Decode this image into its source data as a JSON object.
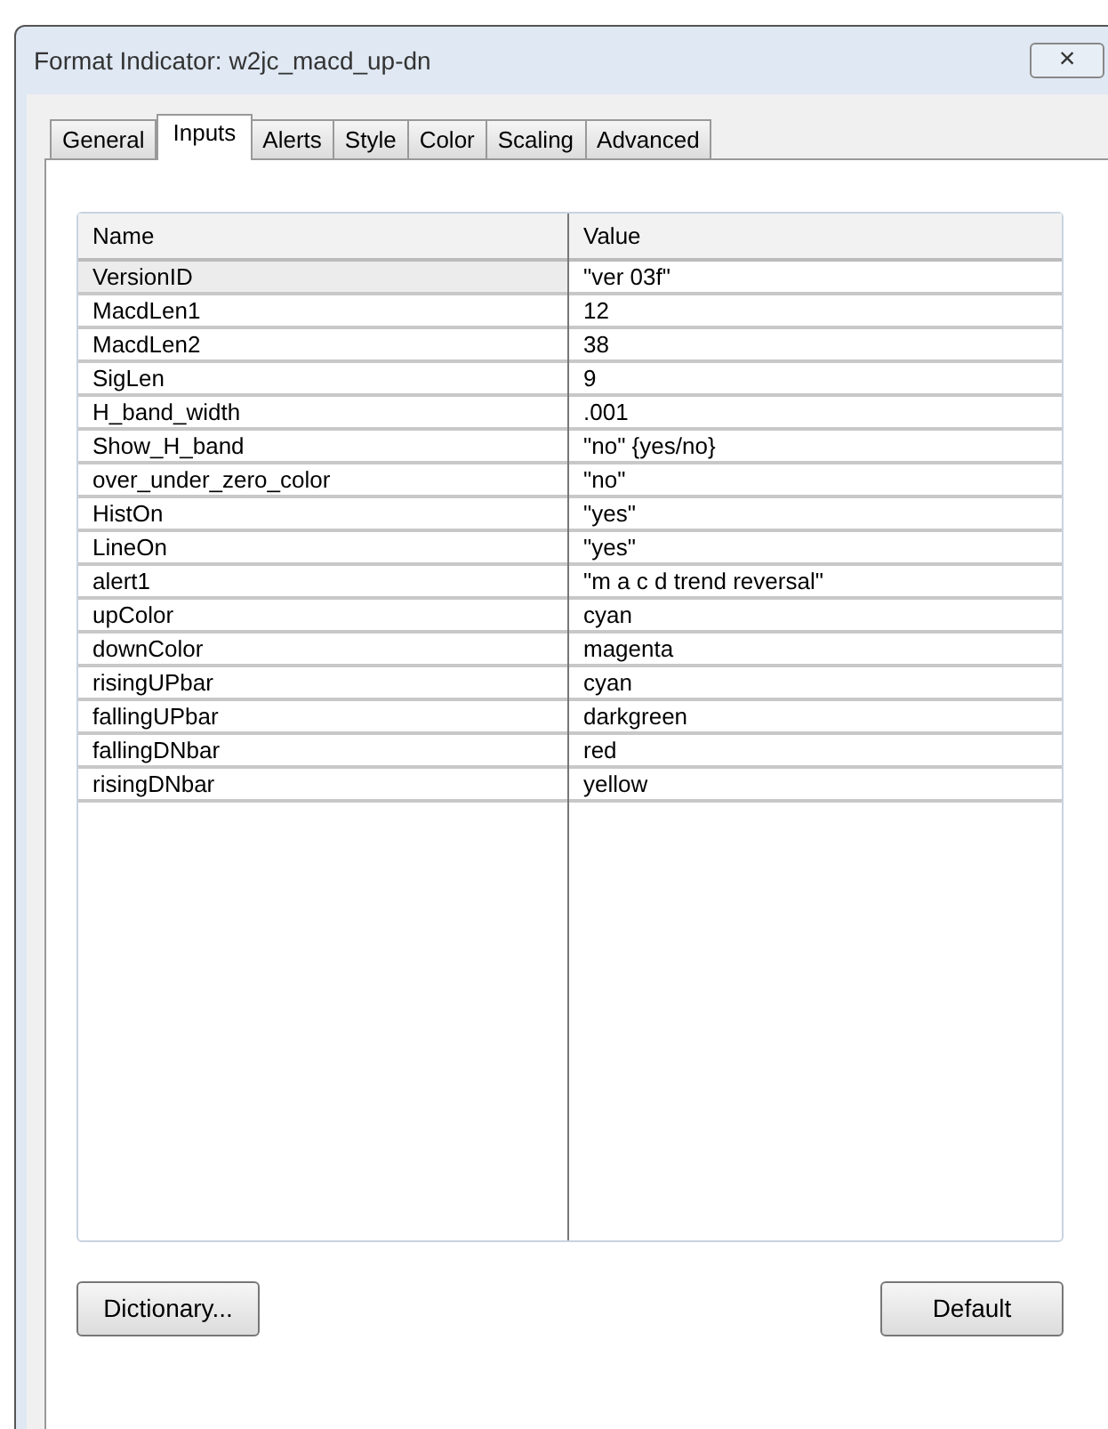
{
  "window": {
    "title": "Format Indicator: w2jc_macd_up-dn",
    "close": "×"
  },
  "tabs": [
    {
      "label": "General",
      "selected": false
    },
    {
      "label": "Inputs",
      "selected": true
    },
    {
      "label": "Alerts",
      "selected": false
    },
    {
      "label": "Style",
      "selected": false
    },
    {
      "label": "Color",
      "selected": false
    },
    {
      "label": "Scaling",
      "selected": false
    },
    {
      "label": "Advanced",
      "selected": false
    }
  ],
  "table": {
    "columns": [
      "Name",
      "Value"
    ],
    "rows": [
      {
        "name": "VersionID",
        "value": "\"ver 03f\"",
        "selected": true
      },
      {
        "name": "MacdLen1",
        "value": "12",
        "selected": false
      },
      {
        "name": "MacdLen2",
        "value": "38",
        "selected": false
      },
      {
        "name": "SigLen",
        "value": "9",
        "selected": false
      },
      {
        "name": "H_band_width",
        "value": ".001",
        "selected": false
      },
      {
        "name": "Show_H_band",
        "value": "\"no\" {yes/no}",
        "selected": false
      },
      {
        "name": "over_under_zero_color",
        "value": "\"no\"",
        "selected": false
      },
      {
        "name": "HistOn",
        "value": "\"yes\"",
        "selected": false
      },
      {
        "name": "LineOn",
        "value": "\"yes\"",
        "selected": false
      },
      {
        "name": "alert1",
        "value": "\"m a c d trend reversal\"",
        "selected": false
      },
      {
        "name": "upColor",
        "value": "cyan",
        "selected": false
      },
      {
        "name": "downColor",
        "value": "magenta",
        "selected": false
      },
      {
        "name": "risingUPbar",
        "value": "cyan",
        "selected": false
      },
      {
        "name": "fallingUPbar",
        "value": "darkgreen",
        "selected": false
      },
      {
        "name": "fallingDNbar",
        "value": "red",
        "selected": false
      },
      {
        "name": "risingDNbar",
        "value": "yellow",
        "selected": false
      }
    ]
  },
  "buttons": [
    "Dictionary...",
    "Default"
  ]
}
